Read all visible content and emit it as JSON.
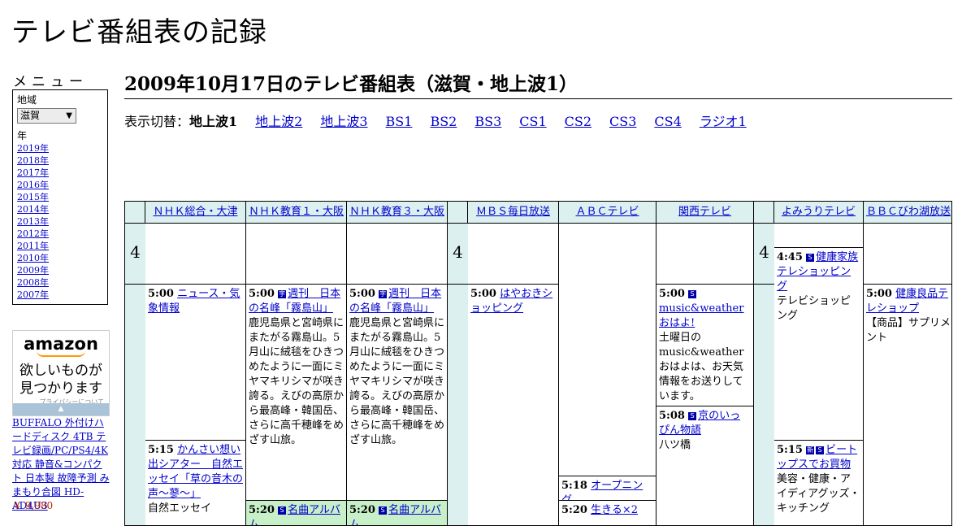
{
  "site_title": "テレビ番組表の記録",
  "sidebar": {
    "menu_heading": "メニュー",
    "region_label": "地域",
    "region_value": "滋賀",
    "year_label": "年",
    "years": [
      "2019年",
      "2018年",
      "2017年",
      "2016年",
      "2015年",
      "2014年",
      "2013年",
      "2012年",
      "2011年",
      "2010年",
      "2009年",
      "2008年",
      "2007年"
    ]
  },
  "ad": {
    "logo": "amazon",
    "copy_line1": "欲しいものが",
    "copy_line2": "見つかります",
    "privacy": "プライバシーについて",
    "product": "BUFFALO 外付けハードディスク 4TB テレビ録画/PC/PS4/4K対応 静音&コンパクト 日本製 故障予測 みまもり合図 HD-AD4U3",
    "price": "￥ 9,980"
  },
  "page_heading": "2009年10月17日のテレビ番組表（滋賀・地上波1）",
  "switcher": {
    "label": "表示切替：",
    "current": "地上波1",
    "links": [
      "地上波2",
      "地上波3",
      "BS1",
      "BS2",
      "BS3",
      "CS1",
      "CS2",
      "CS3",
      "CS4",
      "ラジオ1"
    ]
  },
  "channels": [
    "ＮＨＫ総合・大津",
    "ＮＨＫ教育１・大阪",
    "ＮＨＫ教育３・大阪",
    "ＭＢＳ毎日放送",
    "ＡＢＣテレビ",
    "関西テレビ",
    "よみうりテレビ",
    "ＢＢＣびわ湖放送"
  ],
  "hour_label": "4",
  "programs": {
    "nhk_g_500": {
      "time": "5:00",
      "title": "ニュース・気象情報",
      "desc": ""
    },
    "nhk_g_515": {
      "time": "5:15",
      "title": "かんさい想い出シアター　自然エッセイ「草の音木の声～蓼～」",
      "desc": "自然エッセイ"
    },
    "etv1_500": {
      "time": "5:00",
      "mark": "字",
      "title": "週刊　日本の名峰「霧島山」",
      "desc": "鹿児島県と宮崎県にまたがる霧島山。5月山に絨毯をひきつめたように一面にミヤマキリシマが咲き誇る。えびの高原から最高峰・韓国岳、さらに高千穂峰をめざす山旅。"
    },
    "etv1_520": {
      "time": "5:20",
      "mark": "S",
      "title": "名曲アルバム",
      "desc": ""
    },
    "etv3_500": {
      "time": "5:00",
      "mark": "字",
      "title": "週刊　日本の名峰「霧島山」",
      "desc": "鹿児島県と宮崎県にまたがる霧島山。5月山に絨毯をひきつめたように一面にミヤマキリシマが咲き誇る。えびの高原から最高峰・韓国岳、さらに高千穂峰をめざす山旅。"
    },
    "etv3_520": {
      "time": "5:20",
      "mark": "S",
      "title": "名曲アルバム",
      "desc": ""
    },
    "mbs_500": {
      "time": "5:00",
      "title": "はやおきショッピング",
      "desc": ""
    },
    "abc_518": {
      "time": "5:18",
      "title": "オープニング",
      "desc": ""
    },
    "abc_520": {
      "time": "5:20",
      "title": "生きる×2",
      "desc": ""
    },
    "ktv_500": {
      "time": "5:00",
      "mark": "S",
      "title": "music&weatherおはよ!",
      "desc": "土曜日のmusic&weatherおはよは、お天気情報をお送りしています。"
    },
    "ktv_508": {
      "time": "5:08",
      "mark": "S",
      "title": "京のいっぴん物語",
      "desc": "八ツ橋"
    },
    "ytv_445": {
      "time": "4:45",
      "mark": "S",
      "title": "健康家族テレショッピング",
      "desc": "テレビショッピング"
    },
    "ytv_515": {
      "time": "5:15",
      "mark": "新",
      "mark2": "S",
      "title": "ビートップスでお買物",
      "desc": "美容・健康・アイディアグッズ・キッチング"
    },
    "bbc_500": {
      "time": "5:00",
      "title": "健康良品テレショップ",
      "desc": "【商品】サプリメント"
    }
  }
}
